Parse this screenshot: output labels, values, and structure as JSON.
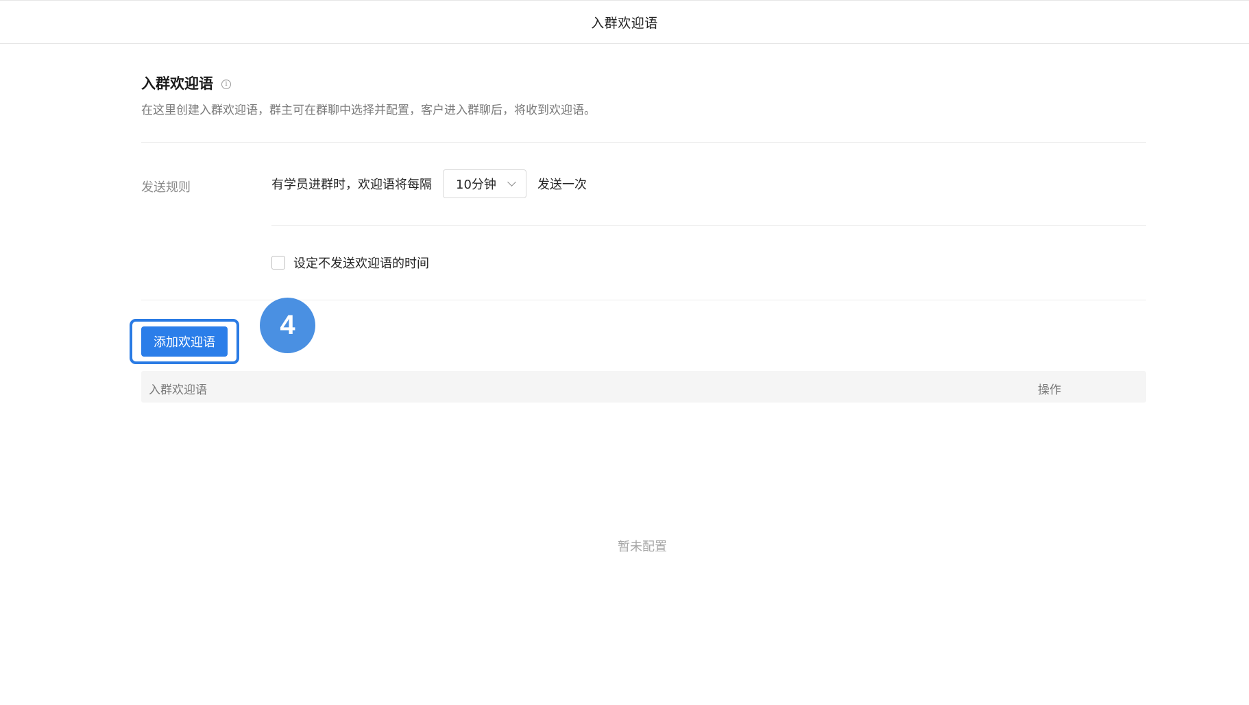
{
  "header": {
    "title": "入群欢迎语"
  },
  "section": {
    "title": "入群欢迎语",
    "info_icon": "info-icon",
    "description": "在这里创建入群欢迎语，群主可在群聊中选择并配置，客户进入群聊后，将收到欢迎语。"
  },
  "rule": {
    "label": "发送规则",
    "prefix_text": "有学员进群时，欢迎语将每隔",
    "interval_value": "10分钟",
    "suffix_text": "发送一次",
    "checkbox_label": "设定不发送欢迎语的时间",
    "checkbox_checked": false
  },
  "actions": {
    "add_button_label": "添加欢迎语",
    "step_badge": "4"
  },
  "table": {
    "columns": [
      "入群欢迎语",
      "操作"
    ],
    "rows": [],
    "empty_text": "暂未配置"
  },
  "colors": {
    "primary": "#2b7ee9",
    "highlight": "#2a7be4",
    "badge": "#4a90e2"
  }
}
